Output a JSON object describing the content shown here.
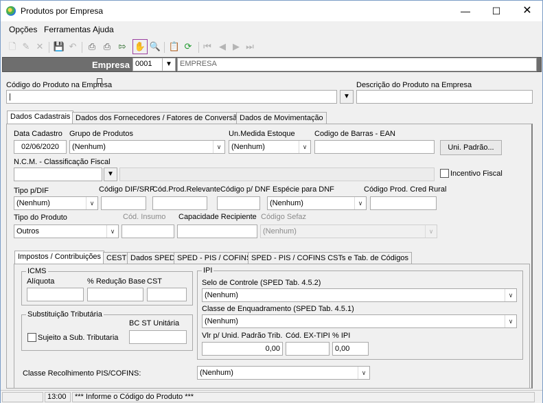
{
  "window": {
    "title": "Produtos por Empresa"
  },
  "menu": [
    "Opções",
    "Ferramentas",
    "Ajuda"
  ],
  "empresa": {
    "label": "Empresa",
    "code": "0001",
    "name": "EMPRESA"
  },
  "produto": {
    "codigo_label": "Código do Produto na Empresa",
    "codigo_value": "|",
    "descricao_label": "Descrição do Produto na Empresa",
    "descricao_value": ""
  },
  "main_tabs": [
    "Dados Cadastrais",
    "Dados dos Fornecedores / Fatores de Conversão",
    "Dados de Movimentação"
  ],
  "cadastro": {
    "data_cadastro_label": "Data Cadastro",
    "data_cadastro": "02/06/2020",
    "grupo_label": "Grupo de Produtos",
    "grupo_value": "(Nenhum)",
    "unmedida_label": "Un.Medida Estoque",
    "unmedida_value": "(Nenhum)",
    "ean_label": "Codigo de Barras - EAN",
    "ean_value": "",
    "uni_padrao_button": "Uni. Padrão...",
    "ncm_label": "N.C.M. - Classificação Fiscal",
    "ncm_value": "",
    "incentivo_label": "Incentivo Fiscal",
    "tipo_dif_label": "Tipo p/DIF",
    "tipo_dif_value": "(Nenhum)",
    "cod_dif_label": "Código DIF/SRF",
    "cod_relevante_label": "Cód.Prod.Relevante",
    "cod_dnf_label": "Código p/ DNF",
    "especie_dnf_label": "Espécie para DNF",
    "especie_dnf_value": "(Nenhum)",
    "cod_cred_rural_label": "Código Prod. Cred Rural",
    "tipo_produto_label": "Tipo do Produto",
    "tipo_produto_value": "Outros",
    "cod_insumo_label": "Cód. Insumo",
    "capacidade_label": "Capacidade Recipiente",
    "cod_sefaz_label": "Código Sefaz",
    "cod_sefaz_value": "(Nenhum)"
  },
  "sub_tabs": [
    "Impostos / Contribuições",
    "CEST",
    "Dados SPED",
    "SPED - PIS / COFINS",
    "SPED - PIS / COFINS CSTs e Tab. de Códigos"
  ],
  "icms": {
    "title": "ICMS",
    "aliquota_label": "Alíquota",
    "reducao_label": "% Redução Base",
    "cst_label": "CST"
  },
  "st": {
    "title": "Substituição Tributária",
    "bc_label": "BC ST Unitária",
    "sujeito_label": "Sujeito a Sub. Tributaria"
  },
  "ipi": {
    "title": "IPI",
    "selo_label": "Selo de Controle (SPED Tab. 4.5.2)",
    "selo_value": "(Nenhum)",
    "classe_label": "Classe de Enquadramento (SPED Tab. 4.5.1)",
    "classe_value": "(Nenhum)",
    "vlr_label": "Vlr p/ Unid. Padrão Trib.",
    "vlr_value": "0,00",
    "ex_tipi_label": "Cód. EX-TIPI",
    "ex_tipi_value": "",
    "pct_ipi_label": "% IPI",
    "pct_ipi_value": "0,00"
  },
  "pis_cofins": {
    "label": "Classe Recolhimento PIS/COFINS:",
    "value": "(Nenhum)"
  },
  "status": {
    "time": "13:00",
    "message": "*** Informe o Código do Produto ***"
  }
}
